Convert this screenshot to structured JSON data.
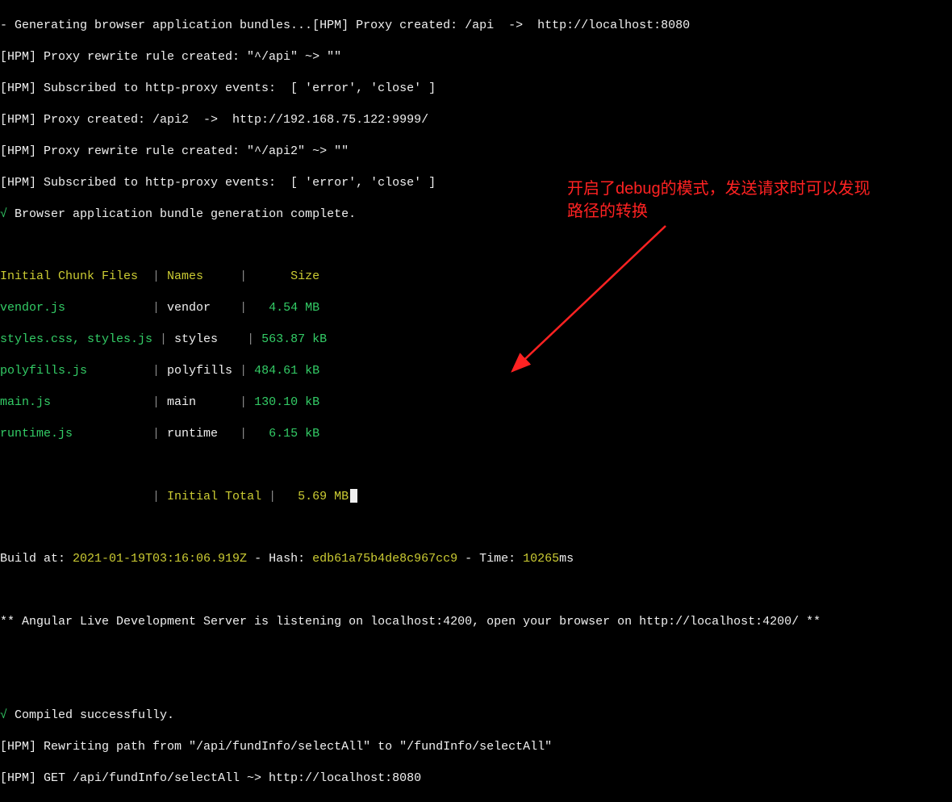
{
  "log": {
    "l1": "- Generating browser application bundles...[HPM] Proxy created: /api  ->  http://localhost:8080",
    "l2": "[HPM] Proxy rewrite rule created: \"^/api\" ~> \"\"",
    "l3": "[HPM] Subscribed to http-proxy events:  [ 'error', 'close' ]",
    "l4": "[HPM] Proxy created: /api2  ->  http://192.168.75.122:9999/",
    "l5": "[HPM] Proxy rewrite rule created: \"^/api2\" ~> \"\"",
    "l6": "[HPM] Subscribed to http-proxy events:  [ 'error', 'close' ]",
    "check1": "√",
    "l7": " Browser application bundle generation complete.",
    "header_files": "Initial Chunk Files",
    "header_names": "Names",
    "header_size": "Size",
    "pipe1": " | ",
    "pipe2": "    |  ",
    "pipe3": "| ",
    "rows": [
      {
        "file": "vendor.js",
        "name": "vendor",
        "size": "4.54 MB"
      },
      {
        "file": "styles.css, styles.js",
        "name": "styles",
        "size": "563.87 kB"
      },
      {
        "file": "polyfills.js",
        "name": "polyfills",
        "size": "484.61 kB"
      },
      {
        "file": "main.js",
        "name": "main",
        "size": "130.10 kB"
      },
      {
        "file": "runtime.js",
        "name": "runtime",
        "size": "6.15 kB"
      }
    ],
    "total_label": "Initial Total",
    "total_size": "5.69 MB",
    "build_prefix": "Build at: ",
    "build_date": "2021-01-19T03:16:06.919Z",
    "dash": " - ",
    "hash_label": "Hash: ",
    "hash_value": "edb61a75b4de8c967cc9",
    "time_label": "Time: ",
    "time_value": "10265",
    "time_unit": "ms",
    "listening": "** Angular Live Development Server is listening on localhost:4200, open your browser on http://localhost:4200/ **",
    "check2": "√",
    "compiled": " Compiled successfully.",
    "rewrite": "[HPM] Rewriting path from \"/api/fundInfo/selectAll\" to \"/fundInfo/selectAll\"",
    "get": "[HPM] GET /api/fundInfo/selectAll ~> http://localhost:8080"
  },
  "annotation": {
    "line1": "开启了debug的模式，发送请求时可以发现",
    "line2": "路径的转换"
  }
}
